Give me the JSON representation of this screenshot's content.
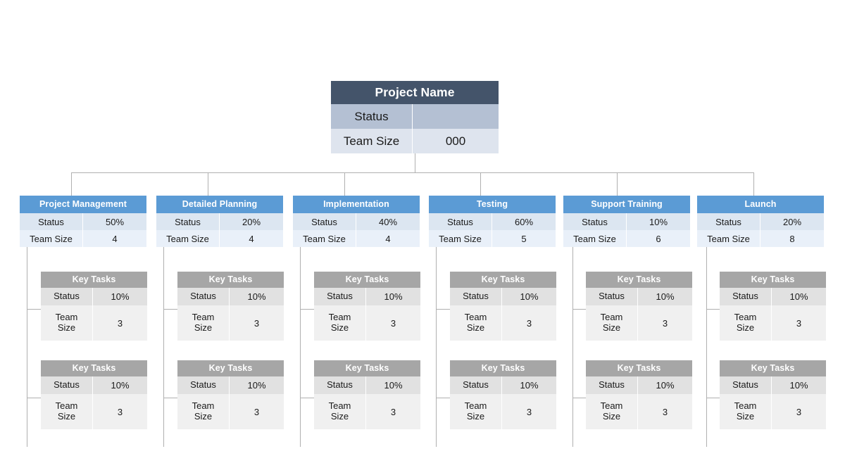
{
  "diagram": {
    "type": "organizational-hierarchy-chart",
    "labels": {
      "status": "Status",
      "team_size": "Team Size",
      "team_size_line1": "Team",
      "team_size_line2": "Size"
    },
    "colors": {
      "root_header": "#44546A",
      "root_status_row": "#B4C0D3",
      "root_team_row": "#DEE4EE",
      "level2_header": "#5B9BD5",
      "level2_status_row": "#DCE6F1",
      "level2_team_row": "#E9F0F9",
      "level3_header": "#A6A6A6",
      "level3_status_row": "#E1E1E1",
      "level3_team_row": "#F0F0F0",
      "connector": "#B0B0B0",
      "canvas": "#FFFFFF"
    },
    "root": {
      "title": "Project Name",
      "status_label": "Status",
      "status_value": "",
      "team_label": "Team Size",
      "team_value": "000"
    },
    "branches": [
      {
        "title": "Project Management",
        "status_label": "Status",
        "status_value": "50%",
        "team_label": "Team Size",
        "team_value": "4",
        "children": [
          {
            "title": "Key Tasks",
            "status_label": "Status",
            "status_value": "10%",
            "team_label": "Team Size",
            "team_value": "3"
          },
          {
            "title": "Key Tasks",
            "status_label": "Status",
            "status_value": "10%",
            "team_label": "Team Size",
            "team_value": "3"
          }
        ]
      },
      {
        "title": "Detailed Planning",
        "status_label": "Status",
        "status_value": "20%",
        "team_label": "Team Size",
        "team_value": "4",
        "children": [
          {
            "title": "Key Tasks",
            "status_label": "Status",
            "status_value": "10%",
            "team_label": "Team Size",
            "team_value": "3"
          },
          {
            "title": "Key Tasks",
            "status_label": "Status",
            "status_value": "10%",
            "team_label": "Team Size",
            "team_value": "3"
          }
        ]
      },
      {
        "title": "Implementation",
        "status_label": "Status",
        "status_value": "40%",
        "team_label": "Team Size",
        "team_value": "4",
        "children": [
          {
            "title": "Key Tasks",
            "status_label": "Status",
            "status_value": "10%",
            "team_label": "Team Size",
            "team_value": "3"
          },
          {
            "title": "Key Tasks",
            "status_label": "Status",
            "status_value": "10%",
            "team_label": "Team Size",
            "team_value": "3"
          }
        ]
      },
      {
        "title": "Testing",
        "status_label": "Status",
        "status_value": "60%",
        "team_label": "Team Size",
        "team_value": "5",
        "children": [
          {
            "title": "Key Tasks",
            "status_label": "Status",
            "status_value": "10%",
            "team_label": "Team Size",
            "team_value": "3"
          },
          {
            "title": "Key Tasks",
            "status_label": "Status",
            "status_value": "10%",
            "team_label": "Team Size",
            "team_value": "3"
          }
        ]
      },
      {
        "title": "Support Training",
        "status_label": "Status",
        "status_value": "10%",
        "team_label": "Team Size",
        "team_value": "6",
        "children": [
          {
            "title": "Key Tasks",
            "status_label": "Status",
            "status_value": "10%",
            "team_label": "Team Size",
            "team_value": "3"
          },
          {
            "title": "Key Tasks",
            "status_label": "Status",
            "status_value": "10%",
            "team_label": "Team Size",
            "team_value": "3"
          }
        ]
      },
      {
        "title": "Launch",
        "status_label": "Status",
        "status_value": "20%",
        "team_label": "Team Size",
        "team_value": "8",
        "children": [
          {
            "title": "Key Tasks",
            "status_label": "Status",
            "status_value": "10%",
            "team_label": "Team Size",
            "team_value": "3"
          },
          {
            "title": "Key Tasks",
            "status_label": "Status",
            "status_value": "10%",
            "team_label": "Team Size",
            "team_value": "3"
          }
        ]
      }
    ]
  }
}
